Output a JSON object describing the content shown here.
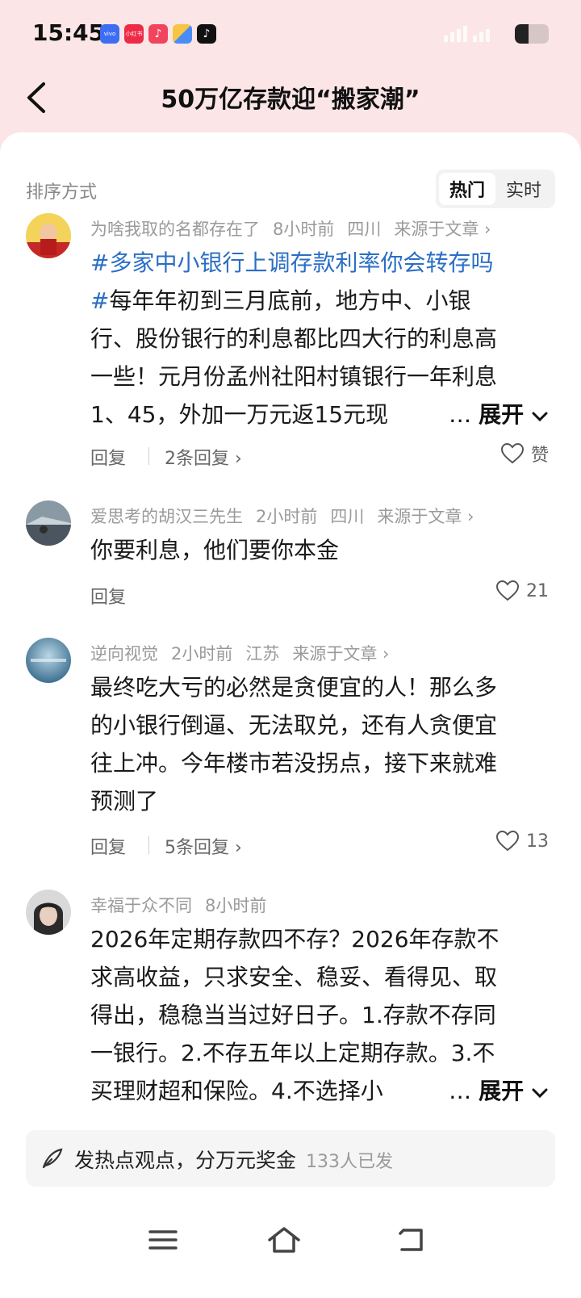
{
  "status_bar": {
    "time": "15:45",
    "app_icons": [
      {
        "name": "vivo-app-icon",
        "label": "vivo",
        "color": "#3d6df2"
      },
      {
        "name": "xiaohongshu-app-icon",
        "label": "小红书",
        "color": "#ee2b47"
      },
      {
        "name": "music-app-icon",
        "label": "♪",
        "color": "#f0455c"
      },
      {
        "name": "files-app-icon",
        "label": "",
        "color": "#4a8cf7"
      },
      {
        "name": "tiktok-app-icon",
        "label": "♪",
        "color": "#111111"
      }
    ],
    "battery_level": 0.4
  },
  "header": {
    "title": "50万亿存款迎“搬家潮”"
  },
  "sort": {
    "label": "排序方式",
    "options": [
      "热门",
      "实时"
    ],
    "active": "热门"
  },
  "comments": [
    {
      "author": "为啥我取的名都存在了",
      "time": "8小时前",
      "location": "四川",
      "source": "来源于文章",
      "hashtag": "#多家中小银行上调存款利率你会转存吗",
      "lines": [
        "#每年年初到三月底前，地方中、小银",
        "行、股份银行的利息都比四大行的利息高",
        "一些！元月份孟州社阳村镇银行一年利息",
        "1、45，外加一万元返15元现"
      ],
      "expand": "展开",
      "reply": "回复",
      "replies": "2条回复",
      "likes": "赞"
    },
    {
      "author": "爱思考的胡汉三先生",
      "time": "2小时前",
      "location": "四川",
      "source": "来源于文章",
      "lines": [
        "你要利息，他们要你本金"
      ],
      "reply": "回复",
      "likes": "21"
    },
    {
      "author": "逆向视觉",
      "time": "2小时前",
      "location": "江苏",
      "source": "来源于文章",
      "lines": [
        "最终吃大亏的必然是贪便宜的人！那么多",
        "的小银行倒逼、无法取兑，还有人贪便宜",
        "往上冲。今年楼市若没拐点，接下来就难",
        "预测了"
      ],
      "reply": "回复",
      "replies": "5条回复",
      "likes": "13"
    },
    {
      "author": "幸福于众不同",
      "time": "8小时前",
      "lines": [
        "2026年定期存款四不存？2026年存款不",
        "求高收益，只求安全、稳妥、看得见、取",
        "得出，稳稳当当过好日子。1.存款不存同",
        "一银行。2.不存五年以上定期存款。3.不",
        "买理财超和保险。4.不选择小"
      ],
      "expand": "展开"
    }
  ],
  "compose": {
    "text": "发热点观点，分万元奖金",
    "count": "133人已发"
  },
  "colors": {
    "header_bg": "#fbe5e6",
    "hashtag": "#2a6ec5"
  }
}
